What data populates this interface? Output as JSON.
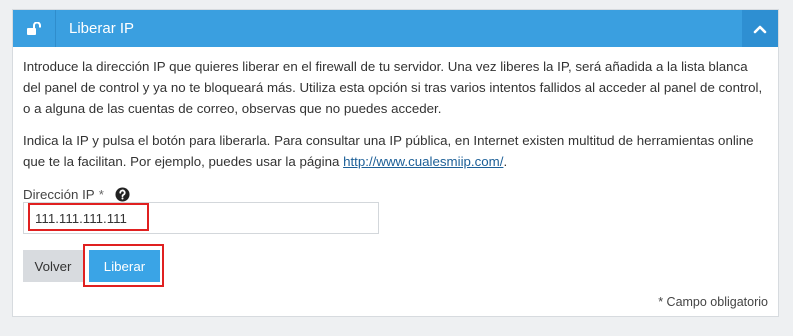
{
  "panel": {
    "title": "Liberar IP",
    "icons": {
      "lock": "unlock-icon",
      "collapse": "chevron-up-icon",
      "help": "question-circle-icon"
    },
    "colors": {
      "header": "#3a9fe0",
      "collapse_bg": "#2e8fd2",
      "primary_button": "#3aa4e6",
      "highlight": "#e02020"
    }
  },
  "content": {
    "intro": "Introduce la dirección IP que quieres liberar en el firewall de tu servidor. Una vez liberes la IP, será añadida a la lista blanca del panel de control y ya no te bloqueará más. Utiliza esta opción si tras varios intentos fallidos al acceder al panel de control, o a alguna de las cuentas de correo, observas que no puedes acceder.",
    "instructions_before_link": "Indica la IP y pulsa el botón para liberarla. Para consultar una IP pública, en Internet existen multitud de herramientas online que te la facilitan. Por ejemplo, puedes usar la página ",
    "link_text": "http://www.cualesmiip.com/",
    "instructions_after_link": "."
  },
  "form": {
    "ip_label": "Dirección IP",
    "required_mark": "*",
    "ip_value": "111.111.111.111",
    "back_button": "Volver",
    "submit_button": "Liberar",
    "required_note": "* Campo obligatorio"
  }
}
